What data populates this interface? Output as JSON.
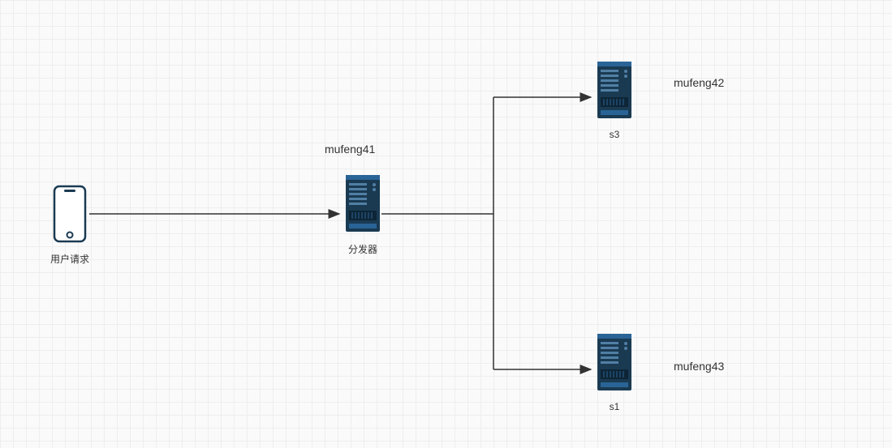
{
  "nodes": {
    "phone": {
      "label": "用户请求"
    },
    "dispatcher": {
      "label_above": "mufeng41",
      "label_below": "分发器"
    },
    "server_top": {
      "label_below": "s3",
      "label_side": "mufeng42"
    },
    "server_bottom": {
      "label_below": "s1",
      "label_side": "mufeng43"
    }
  },
  "icons": {
    "phone": "phone-icon",
    "server": "server-icon"
  },
  "colors": {
    "server_dark": "#1a3a52",
    "server_light": "#2a6496",
    "arrow": "#333333",
    "grid": "#eeeeee"
  }
}
